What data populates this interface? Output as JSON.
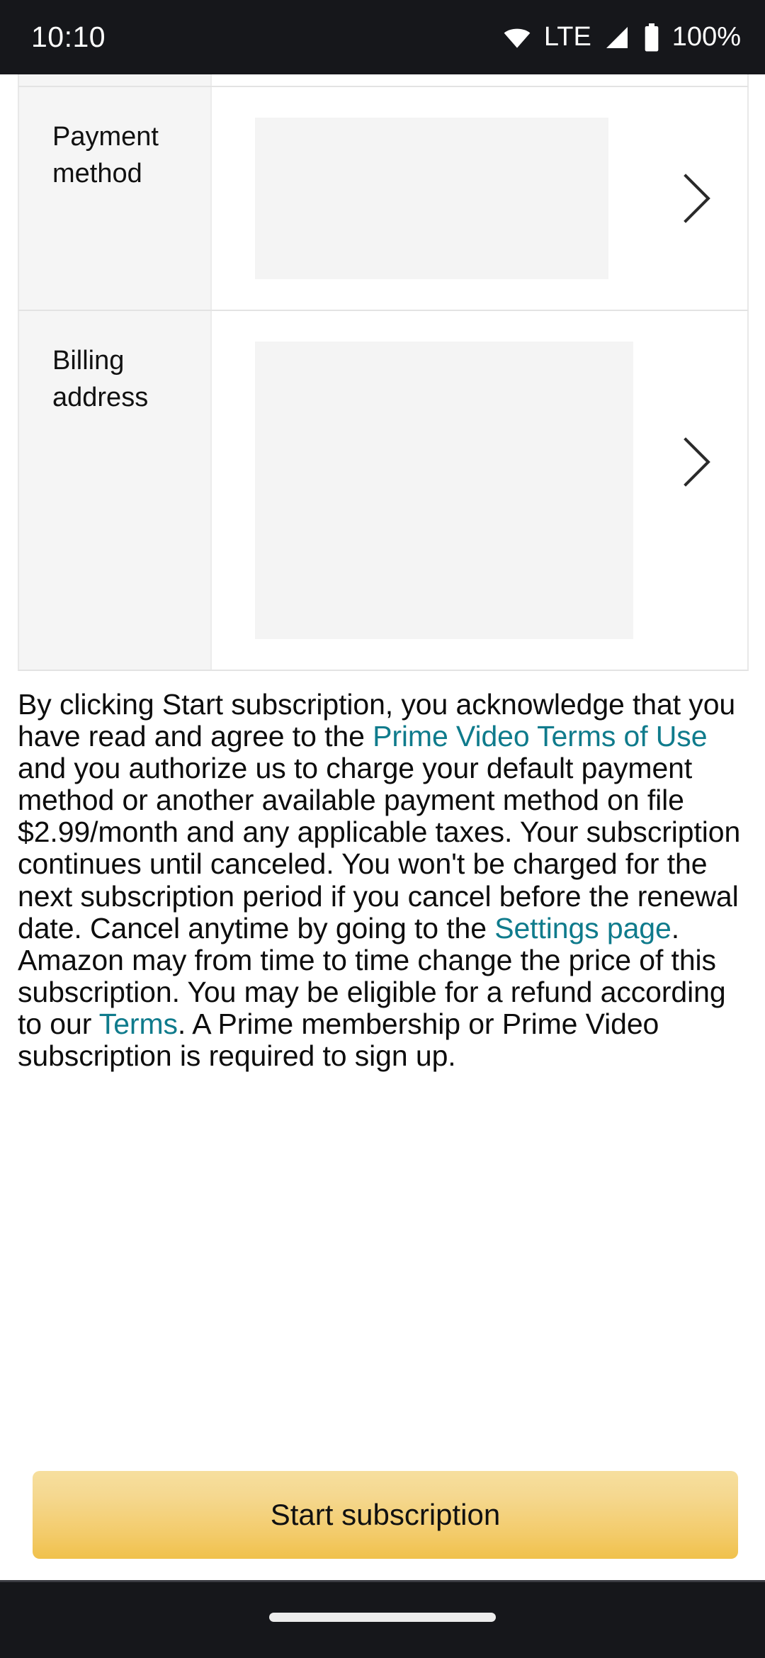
{
  "status_bar": {
    "time": "10:10",
    "network_label": "LTE",
    "battery_percent": "100%",
    "icons": {
      "wifi": "wifi-icon",
      "signal": "cellular-signal-icon",
      "battery": "battery-icon"
    }
  },
  "form_table": {
    "rows": [
      {
        "label": "Payment method",
        "value": "",
        "chevron": "chevron-right-icon"
      },
      {
        "label": "Billing address",
        "value": "",
        "chevron": "chevron-right-icon"
      }
    ]
  },
  "legal": {
    "part1": "By clicking Start subscription, you acknowledge that you have read and agree to the ",
    "link1": "Prime Video Terms of Use",
    "part2": " and you authorize us to charge your default payment method or another available payment method on file $2.99/month and any applicable taxes. Your subscription continues until canceled. You won't be charged for the next subscription period if you cancel before the renewal date. Cancel anytime by going to the ",
    "link2": "Settings page",
    "part3": ". Amazon may from time to time change the price of this subscription. You may be eligible for a refund according to our ",
    "link3": "Terms",
    "part4": ". A Prime membership or Prime Video subscription is required to sign up.",
    "price": "$2.99/month",
    "link_color": "#0f7b8c"
  },
  "cta": {
    "label": "Start subscription",
    "gradient_top": "#f6df9e",
    "gradient_bottom": "#f0c14b"
  },
  "nav_bar": {
    "gesture_handle": "home-gesture-pill"
  }
}
